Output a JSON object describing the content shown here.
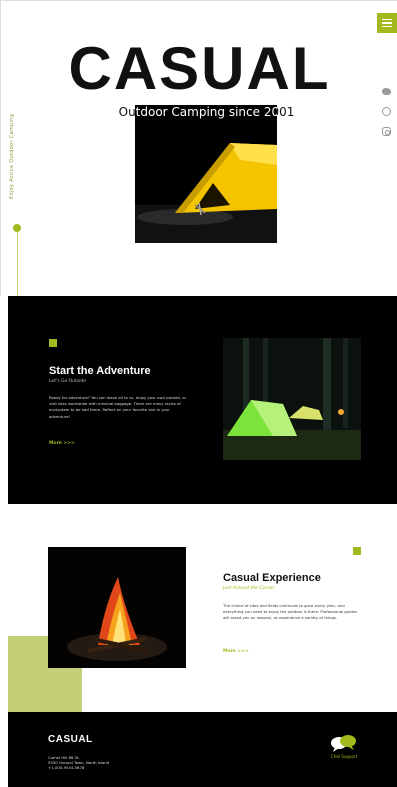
{
  "hero": {
    "brand": "CASUAL",
    "subtitle": "Outdoor Camping since 2001",
    "side_tagline": "Enjoy Active Outdoor Camping",
    "social_icons": [
      "twitter-icon",
      "facebook-icon",
      "instagram-icon"
    ],
    "photo": "yellow tent at night"
  },
  "adventure": {
    "title": "Start the Adventure",
    "subtitle": "Let's Go Outside",
    "body": "Ready for adventure? You can leave all to us, enjoy your own packed, or visit sites worldwide with minimal baggage. There are many styles of ecosystem to be had there. Reflect on your favorite one in your adventure!",
    "more": "More >>>"
  },
  "experience": {
    "title": "Casual Experience",
    "subtitle": "Just Around the Corner",
    "body": "The choice of sites and fields continues to grow every year, and everything you need to enjoy the outdoor is there. Professional guides will assist you on request, as experience a variety of things.",
    "more": "More >>>"
  },
  "footer": {
    "brand": "CASUAL",
    "address_line1": "Camel Hill 88 St.",
    "address_line2": "5550 Ground Town, North Island",
    "address_line3": "+1-000-9534-5678",
    "chat_label": "Chat Support"
  },
  "colors": {
    "accent": "#a3b81c",
    "accent_light": "#c4cf78",
    "dark": "#000000"
  }
}
